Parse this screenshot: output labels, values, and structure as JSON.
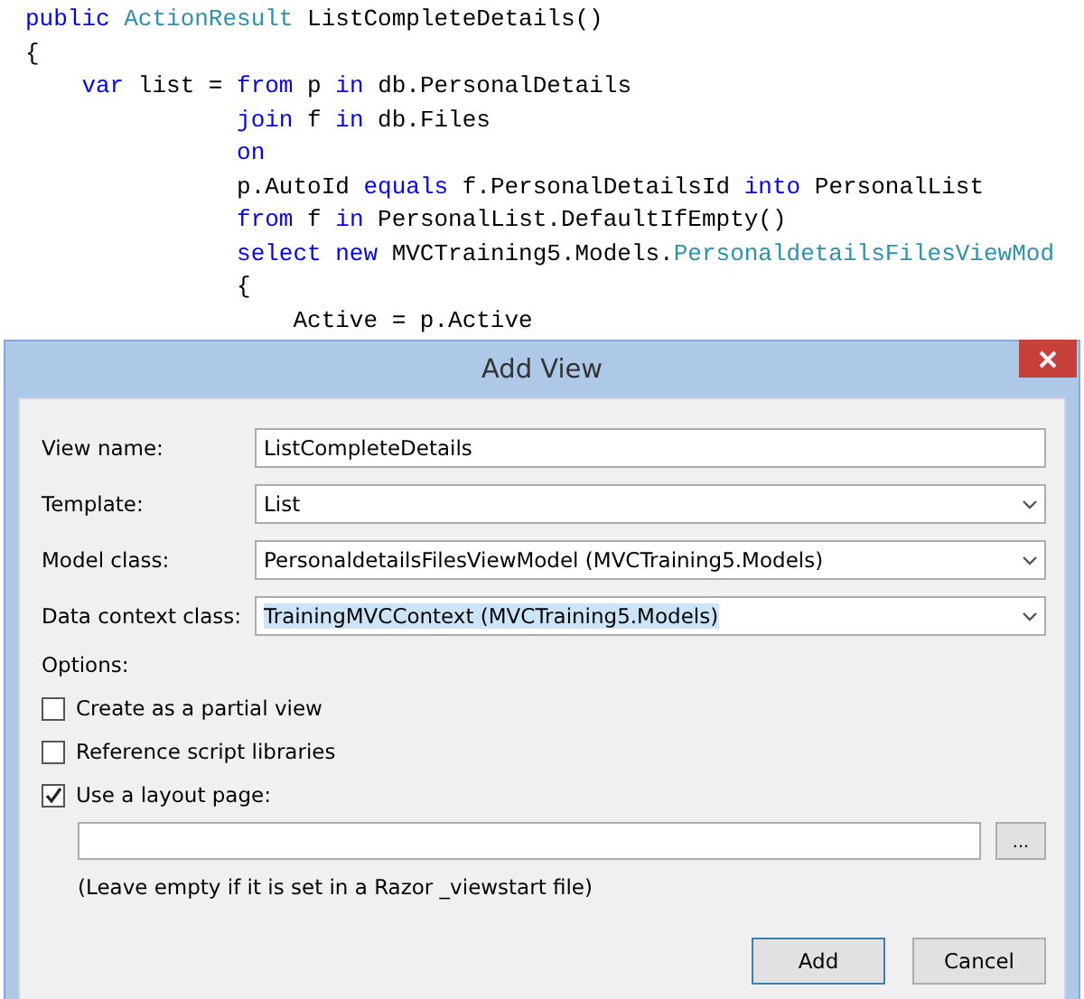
{
  "code": {
    "lines": [
      {
        "kind": "signature",
        "tokens": [
          {
            "kind": "keyword",
            "text": "public"
          },
          {
            "kind": "type",
            "text": " ActionResult"
          },
          {
            "kind": "plain",
            "text": " ListCompleteDetails()"
          }
        ]
      },
      {
        "kind": "signature",
        "tokens": [
          {
            "kind": "plain",
            "text": "{"
          }
        ]
      },
      {
        "kind": "statement",
        "tokens": [
          {
            "kind": "keyword",
            "text": "var"
          },
          {
            "kind": "plain",
            "text": " list = "
          },
          {
            "kind": "keyword",
            "text": "from"
          },
          {
            "kind": "plain",
            "text": " p "
          },
          {
            "kind": "keyword",
            "text": "in"
          },
          {
            "kind": "plain",
            "text": " db.PersonalDetails"
          }
        ]
      },
      {
        "kind": "clause",
        "tokens": [
          {
            "kind": "keyword",
            "text": "join"
          },
          {
            "kind": "plain",
            "text": " f "
          },
          {
            "kind": "keyword",
            "text": "in"
          },
          {
            "kind": "plain",
            "text": " db.Files"
          }
        ]
      },
      {
        "kind": "clause",
        "tokens": [
          {
            "kind": "keyword",
            "text": "on"
          }
        ]
      },
      {
        "kind": "clause",
        "tokens": [
          {
            "kind": "plain",
            "text": "p.AutoId "
          },
          {
            "kind": "keyword",
            "text": "equals"
          },
          {
            "kind": "plain",
            "text": " f.PersonalDetailsId "
          },
          {
            "kind": "keyword",
            "text": "into"
          },
          {
            "kind": "plain",
            "text": " PersonalList"
          }
        ]
      },
      {
        "kind": "clause",
        "tokens": [
          {
            "kind": "keyword",
            "text": "from"
          },
          {
            "kind": "plain",
            "text": " f "
          },
          {
            "kind": "keyword",
            "text": "in"
          },
          {
            "kind": "plain",
            "text": " PersonalList.DefaultIfEmpty()"
          }
        ]
      },
      {
        "kind": "clause",
        "tokens": [
          {
            "kind": "keyword",
            "text": "select new"
          },
          {
            "kind": "plain",
            "text": " MVCTraining5.Models."
          },
          {
            "kind": "type",
            "text": "PersonaldetailsFilesViewMod"
          }
        ]
      },
      {
        "kind": "clause",
        "tokens": [
          {
            "kind": "plain",
            "text": "{"
          }
        ]
      },
      {
        "kind": "member",
        "tokens": [
          {
            "kind": "plain",
            "text": "Active = p.Active"
          }
        ]
      }
    ]
  },
  "dialog": {
    "title": "Add View",
    "fields": [
      {
        "label": "View name:",
        "kind": "text",
        "value": "ListCompleteDetails",
        "highlighted": false
      },
      {
        "label": "Template:",
        "kind": "dropdown",
        "value": "List",
        "highlighted": false
      },
      {
        "label": "Model class:",
        "kind": "dropdown",
        "value": "PersonaldetailsFilesViewModel (MVCTraining5.Models)",
        "highlighted": false
      },
      {
        "label": "Data context class:",
        "kind": "dropdown",
        "value": "TrainingMVCContext (MVCTraining5.Models)",
        "highlighted": true
      }
    ],
    "options_label": "Options:",
    "options": [
      {
        "label": "Create as a partial view",
        "checked": false
      },
      {
        "label": "Reference script libraries",
        "checked": false
      },
      {
        "label": "Use a layout page:",
        "checked": true
      }
    ],
    "browse_button": "...",
    "hint": "(Leave empty if it is set in a Razor _viewstart file)",
    "buttons": [
      {
        "label": "Add",
        "default": true
      },
      {
        "label": "Cancel",
        "default": false
      }
    ]
  }
}
